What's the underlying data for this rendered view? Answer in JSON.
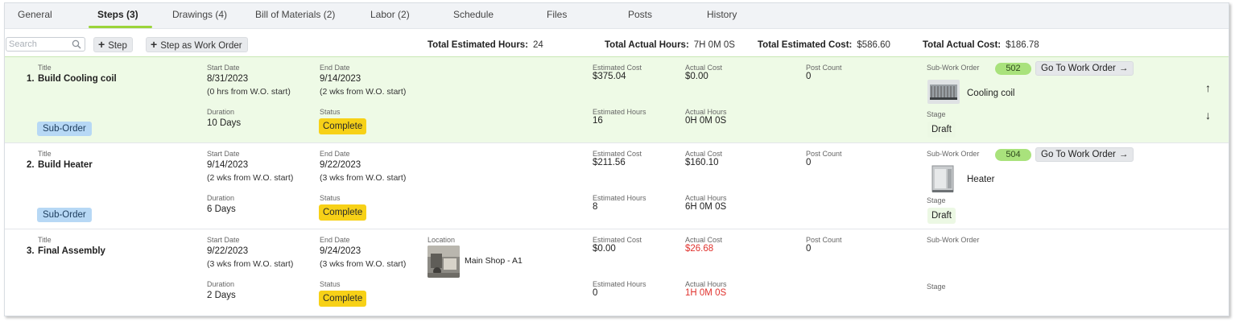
{
  "tabs": [
    {
      "label": "General"
    },
    {
      "label": "Steps (3)"
    },
    {
      "label": "Drawings (4)"
    },
    {
      "label": "Bill of Materials (2)"
    },
    {
      "label": "Labor (2)"
    },
    {
      "label": "Schedule"
    },
    {
      "label": "Files"
    },
    {
      "label": "Posts"
    },
    {
      "label": "History"
    }
  ],
  "toolbar": {
    "search_placeholder": "Search",
    "step_label": "Step",
    "step_wo_label": "Step as Work Order"
  },
  "summary": {
    "est_hours_label": "Total Estimated Hours:",
    "est_hours": "24",
    "act_hours_label": "Total Actual Hours:",
    "act_hours": "7H 0M 0S",
    "est_cost_label": "Total Estimated Cost:",
    "est_cost": "$586.60",
    "act_cost_label": "Total Actual Cost:",
    "act_cost": "$186.78"
  },
  "labels": {
    "title": "Title",
    "start": "Start Date",
    "end": "End Date",
    "duration": "Duration",
    "status": "Status",
    "location": "Location",
    "est_cost": "Estimated Cost",
    "act_cost": "Actual Cost",
    "est_hours": "Estimated Hours",
    "act_hours": "Actual Hours",
    "post_count": "Post Count",
    "sub_wo": "Sub-Work Order",
    "stage": "Stage",
    "go_to_wo": "Go To Work Order"
  },
  "steps": [
    {
      "num": "1.",
      "title": "Build Cooling coil",
      "start": "8/31/2023",
      "start_note": "(0 hrs from W.O. start)",
      "end": "9/14/2023",
      "end_note": "(2 wks from W.O. start)",
      "duration": "10 Days",
      "status": "Complete",
      "type_badge": "Sub-Order",
      "est_cost": "$375.04",
      "act_cost": "$0.00",
      "est_hours": "16",
      "act_hours": "0H 0M 0S",
      "post_count": "0",
      "wo_number": "502",
      "wo_name": "Cooling coil",
      "stage": "Draft"
    },
    {
      "num": "2.",
      "title": "Build Heater",
      "start": "9/14/2023",
      "start_note": "(2 wks from W.O. start)",
      "end": "9/22/2023",
      "end_note": "(3 wks from W.O. start)",
      "duration": "6 Days",
      "status": "Complete",
      "type_badge": "Sub-Order",
      "est_cost": "$211.56",
      "act_cost": "$160.10",
      "est_hours": "8",
      "act_hours": "6H 0M 0S",
      "post_count": "0",
      "wo_number": "504",
      "wo_name": "Heater",
      "stage": "Draft"
    },
    {
      "num": "3.",
      "title": "Final Assembly",
      "start": "9/22/2023",
      "start_note": "(3 wks from W.O. start)",
      "end": "9/24/2023",
      "end_note": "(3 wks from W.O. start)",
      "duration": "2 Days",
      "status": "Complete",
      "location": "Main Shop - A1",
      "est_cost": "$0.00",
      "act_cost": "$26.68",
      "est_hours": "0",
      "act_hours": "1H 0M 0S",
      "post_count": "0"
    }
  ],
  "colors": {
    "accent": "#9bd43a",
    "highlight_row": "#eefae6",
    "status_complete": "#f7d117",
    "sub_order_badge": "#b7d8f5",
    "wo_number_pill": "#a9e27c",
    "over_budget": "#e0322d"
  },
  "icons": [
    "search-icon",
    "plus-icon",
    "arrow-right-icon",
    "arrow-up-icon",
    "arrow-down-icon"
  ]
}
